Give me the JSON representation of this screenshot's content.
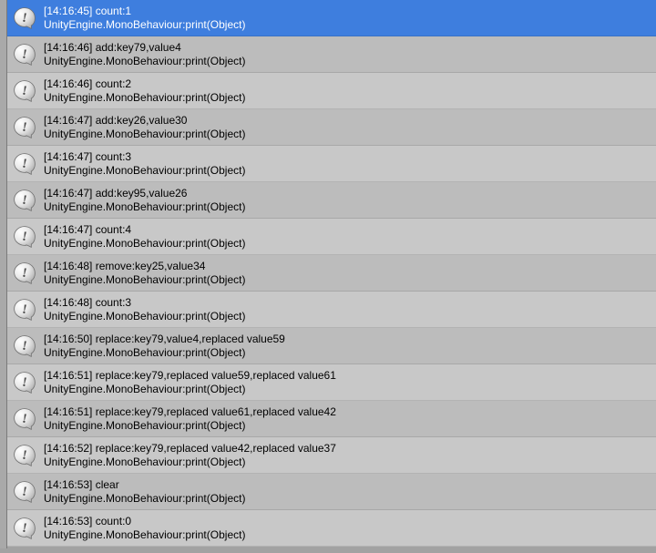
{
  "console": {
    "source_line": "UnityEngine.MonoBehaviour:print(Object)",
    "selected_index": 0,
    "entries": [
      {
        "timestamp": "[14:16:45]",
        "message": "count:1"
      },
      {
        "timestamp": "[14:16:46]",
        "message": "add:key79,value4"
      },
      {
        "timestamp": "[14:16:46]",
        "message": "count:2"
      },
      {
        "timestamp": "[14:16:47]",
        "message": "add:key26,value30"
      },
      {
        "timestamp": "[14:16:47]",
        "message": "count:3"
      },
      {
        "timestamp": "[14:16:47]",
        "message": "add:key95,value26"
      },
      {
        "timestamp": "[14:16:47]",
        "message": "count:4"
      },
      {
        "timestamp": "[14:16:48]",
        "message": "remove:key25,value34"
      },
      {
        "timestamp": "[14:16:48]",
        "message": "count:3"
      },
      {
        "timestamp": "[14:16:50]",
        "message": "replace:key79,value4,replaced value59"
      },
      {
        "timestamp": "[14:16:51]",
        "message": "replace:key79,replaced value59,replaced value61"
      },
      {
        "timestamp": "[14:16:51]",
        "message": "replace:key79,replaced value61,replaced value42"
      },
      {
        "timestamp": "[14:16:52]",
        "message": "replace:key79,replaced value42,replaced value37"
      },
      {
        "timestamp": "[14:16:53]",
        "message": "clear"
      },
      {
        "timestamp": "[14:16:53]",
        "message": "count:0"
      }
    ]
  },
  "icons": {
    "info": "info-icon"
  }
}
